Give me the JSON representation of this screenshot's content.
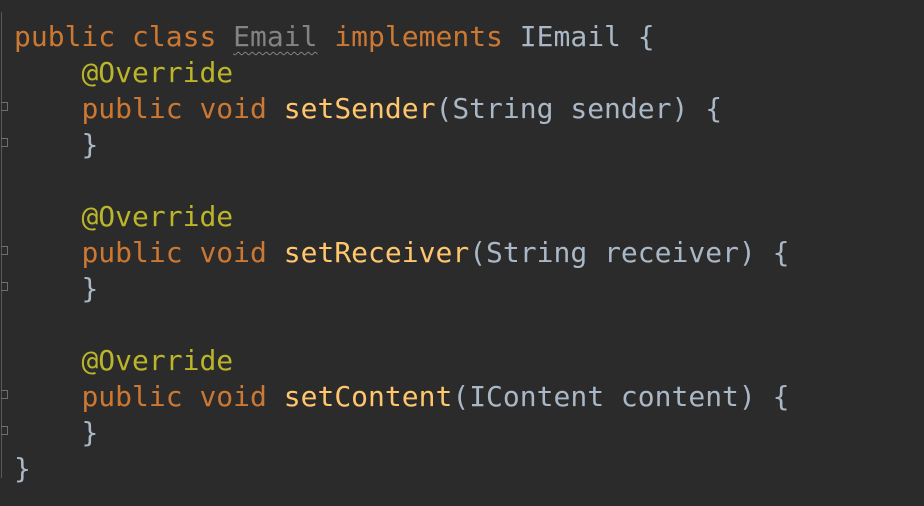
{
  "code": {
    "class_decl": {
      "kw_public": "public",
      "kw_class": "class",
      "name": "Email",
      "kw_implements": "implements",
      "interface": "IEmail",
      "open": "{"
    },
    "methods": [
      {
        "annotation": "@Override",
        "kw_public": "public",
        "kw_void": "void",
        "name": "setSender",
        "open_paren": "(",
        "param_type": "String",
        "param_name": "sender",
        "close_paren": ")",
        "open_brace": "{",
        "close_brace": "}"
      },
      {
        "annotation": "@Override",
        "kw_public": "public",
        "kw_void": "void",
        "name": "setReceiver",
        "open_paren": "(",
        "param_type": "String",
        "param_name": "receiver",
        "close_paren": ")",
        "open_brace": "{",
        "close_brace": "}"
      },
      {
        "annotation": "@Override",
        "kw_public": "public",
        "kw_void": "void",
        "name": "setContent",
        "open_paren": "(",
        "param_type": "IContent",
        "param_name": "content",
        "close_paren": ")",
        "open_brace": "{",
        "close_brace": "}"
      }
    ],
    "class_close": "}"
  },
  "colors": {
    "background": "#2b2b2b",
    "keyword": "#cc7832",
    "annotation": "#bbb529",
    "method_name": "#ffc66d",
    "identifier": "#a9b7c6",
    "unused_class_name": "#838383"
  }
}
